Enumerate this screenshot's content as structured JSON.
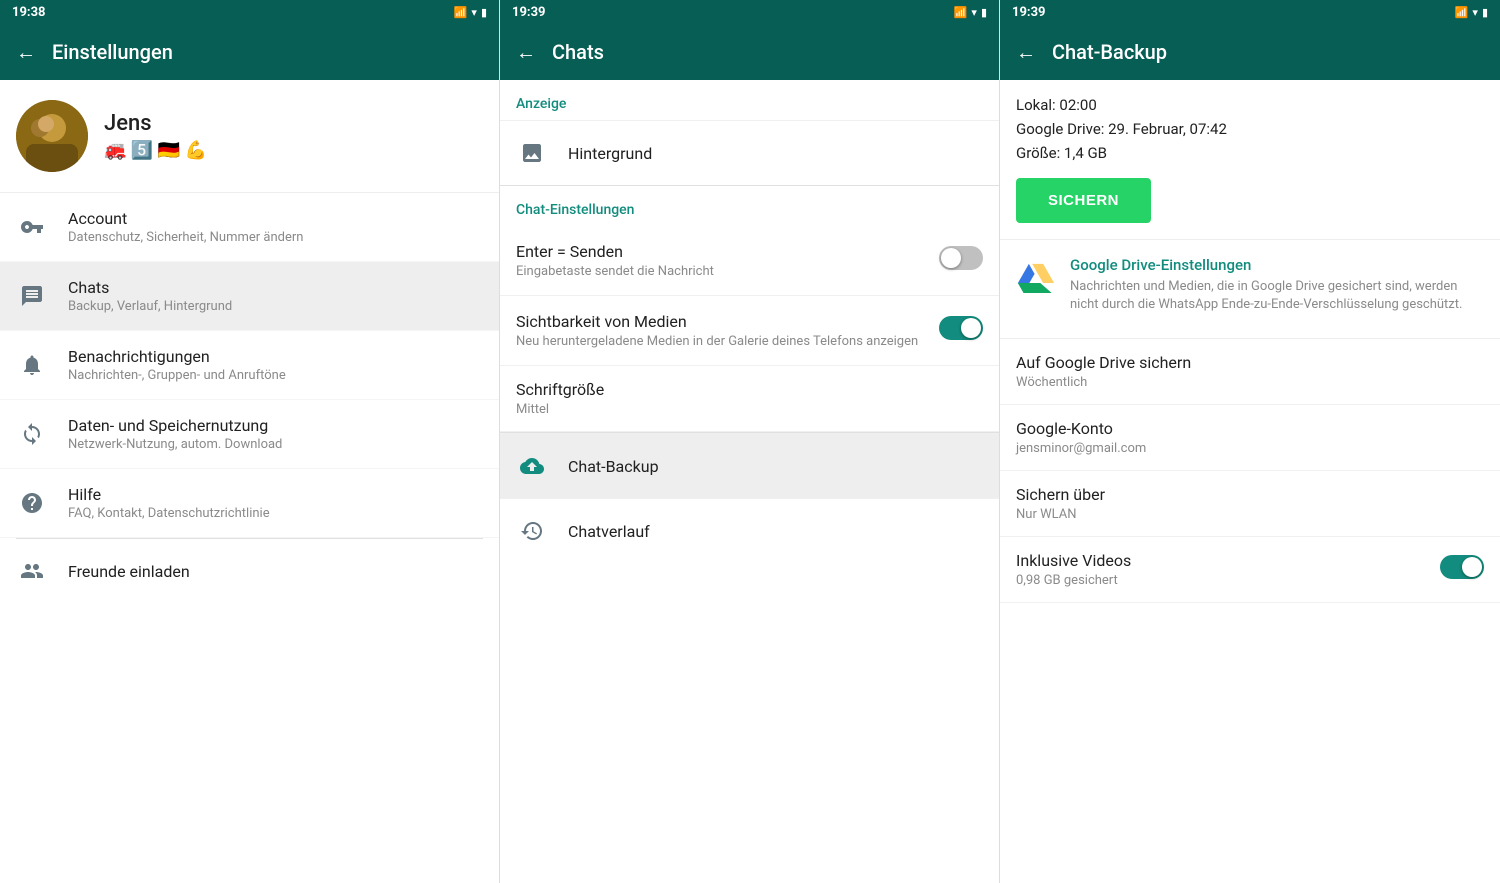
{
  "panels": {
    "left": {
      "statusBar": {
        "time": "19:38",
        "icons": "📱▾✦✗↻"
      },
      "header": {
        "backLabel": "←",
        "title": "Einstellungen"
      },
      "profile": {
        "name": "Jens",
        "emoji": "🚒 5️⃣ 🇩🇪 💪",
        "avatarAlt": "profile photo"
      },
      "menuItems": [
        {
          "id": "account",
          "label": "Account",
          "sublabel": "Datenschutz, Sicherheit, Nummer ändern",
          "iconType": "key"
        },
        {
          "id": "chats",
          "label": "Chats",
          "sublabel": "Backup, Verlauf, Hintergrund",
          "iconType": "chat",
          "active": true
        },
        {
          "id": "notifications",
          "label": "Benachrichtigungen",
          "sublabel": "Nachrichten-, Gruppen- und Anruftöne",
          "iconType": "bell"
        },
        {
          "id": "data",
          "label": "Daten- und Speichernutzung",
          "sublabel": "Netzwerk-Nutzung, autom. Download",
          "iconType": "sync"
        },
        {
          "id": "help",
          "label": "Hilfe",
          "sublabel": "FAQ, Kontakt, Datenschutzrichtlinie",
          "iconType": "help"
        }
      ],
      "invite": {
        "label": "Freunde einladen",
        "iconType": "people"
      }
    },
    "mid": {
      "statusBar": {
        "time": "19:39"
      },
      "header": {
        "backLabel": "←",
        "title": "Chats"
      },
      "sections": [
        {
          "id": "anzeige",
          "header": "Anzeige",
          "items": [
            {
              "id": "hintergrund",
              "label": "Hintergrund",
              "iconType": "image"
            }
          ]
        },
        {
          "id": "chat-einstellungen",
          "header": "Chat-Einstellungen",
          "settings": [
            {
              "id": "enter-senden",
              "label": "Enter = Senden",
              "sublabel": "Eingabetaste sendet die Nachricht",
              "toggleState": "off"
            },
            {
              "id": "sichtbarkeit",
              "label": "Sichtbarkeit von Medien",
              "sublabel": "Neu heruntergeladene Medien in der Galerie deines Telefons anzeigen",
              "toggleState": "on"
            },
            {
              "id": "schriftgroesse",
              "label": "Schriftgröße",
              "value": "Mittel"
            }
          ]
        }
      ],
      "listItems": [
        {
          "id": "chat-backup",
          "label": "Chat-Backup",
          "iconType": "cloud-upload",
          "active": true
        },
        {
          "id": "chatverlauf",
          "label": "Chatverlauf",
          "iconType": "history"
        }
      ]
    },
    "right": {
      "statusBar": {
        "time": "19:39"
      },
      "header": {
        "backLabel": "←",
        "title": "Chat-Backup"
      },
      "backupInfo": {
        "lokal": "Lokal: 02:00",
        "googleDrive": "Google Drive: 29. Februar, 07:42",
        "groesse": "Größe: 1,4 GB",
        "buttonLabel": "SICHERN"
      },
      "googleDrive": {
        "title": "Google Drive-Einstellungen",
        "description": "Nachrichten und Medien, die in Google Drive gesichert sind, werden nicht durch die WhatsApp Ende-zu-Ende-Verschlüsselung geschützt."
      },
      "driveSettings": [
        {
          "id": "auf-google-drive",
          "label": "Auf Google Drive sichern",
          "value": "Wöchentlich"
        },
        {
          "id": "google-konto",
          "label": "Google-Konto",
          "value": "jensminor@gmail.com"
        },
        {
          "id": "sichern-ueber",
          "label": "Sichern über",
          "value": "Nur WLAN"
        },
        {
          "id": "inklusive-videos",
          "label": "Inklusive Videos",
          "value": "0,98 GB gesichert",
          "toggleState": "on"
        }
      ]
    }
  }
}
